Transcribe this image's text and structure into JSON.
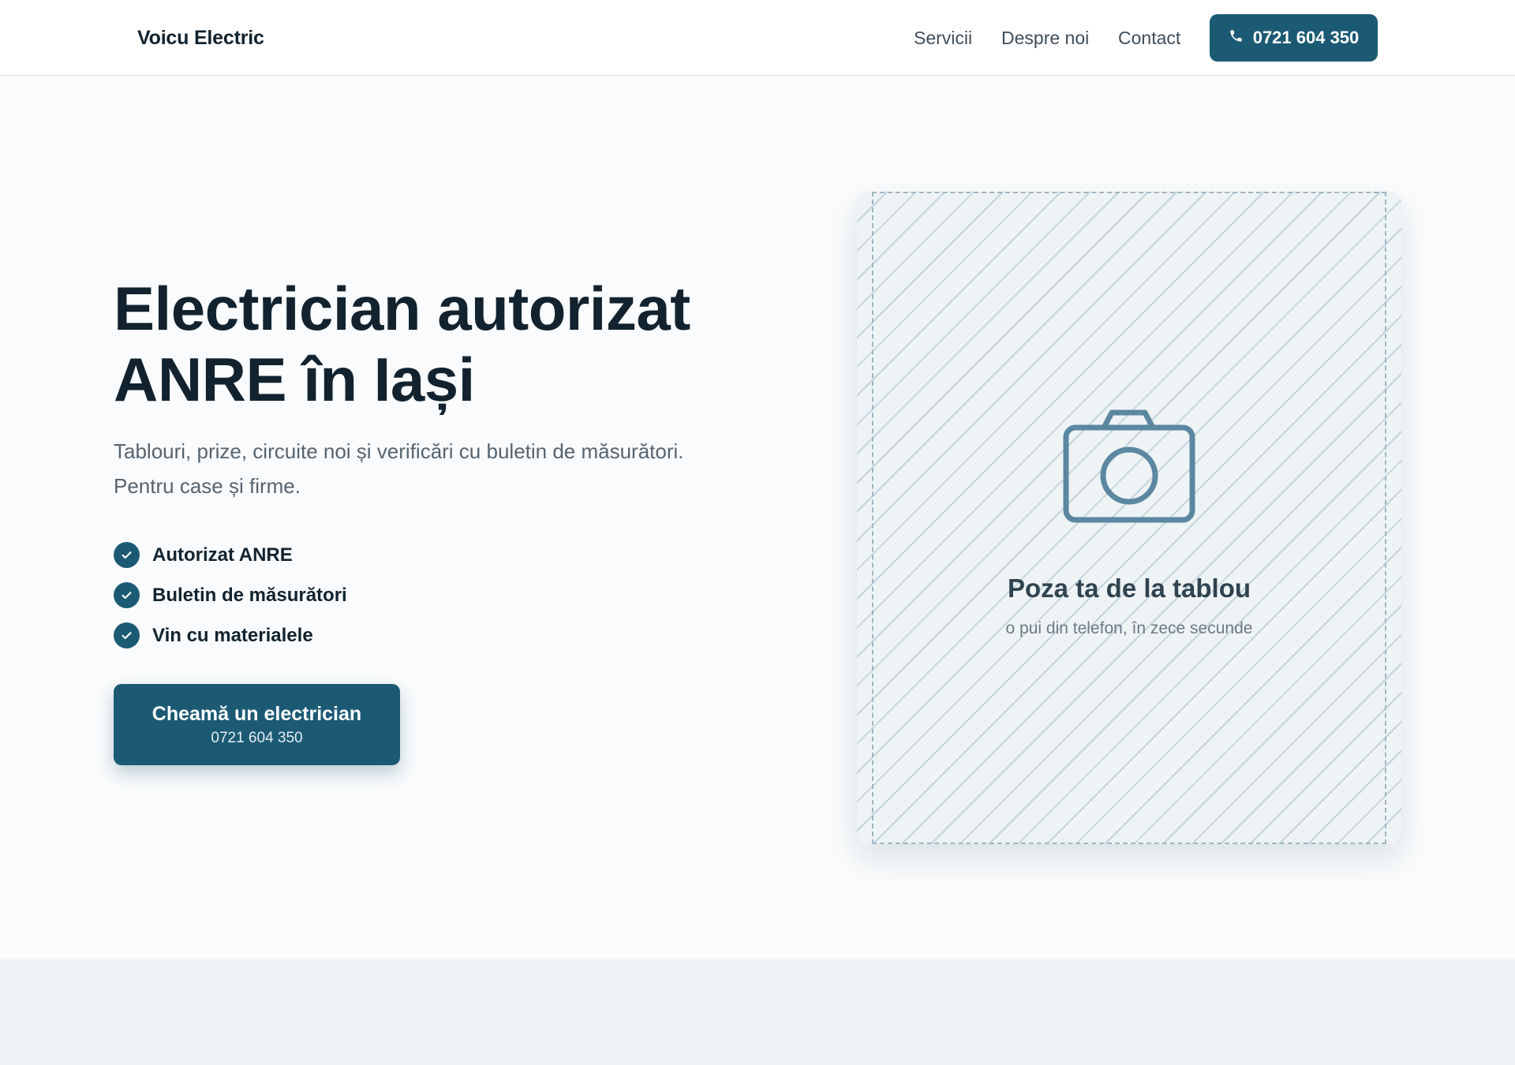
{
  "header": {
    "brand": "Voicu Electric",
    "nav": [
      "Servicii",
      "Despre noi",
      "Contact"
    ],
    "phone": "0721 604 350"
  },
  "hero": {
    "title_line1": "Electrician autorizat",
    "title_line2": "ANRE în Iași",
    "subtitle_line1": "Tablouri, prize, circuite noi și verificări cu buletin de măsurători.",
    "subtitle_line2": "Pentru case și firme.",
    "features": [
      "Autorizat ANRE",
      "Buletin de măsurători",
      "Vin cu materialele"
    ],
    "cta": {
      "label": "Cheamă un electrician",
      "phone": "0721 604 350"
    }
  },
  "photo": {
    "title": "Poza ta de la tablou",
    "subtitle": "o pui din telefon, în zece secunde"
  },
  "icons": {
    "phone": "phone-icon",
    "check": "check-icon",
    "camera": "camera-icon"
  },
  "colors": {
    "primary": "#1c5a74",
    "text": "#12232f",
    "background": "#f9fbfc"
  }
}
